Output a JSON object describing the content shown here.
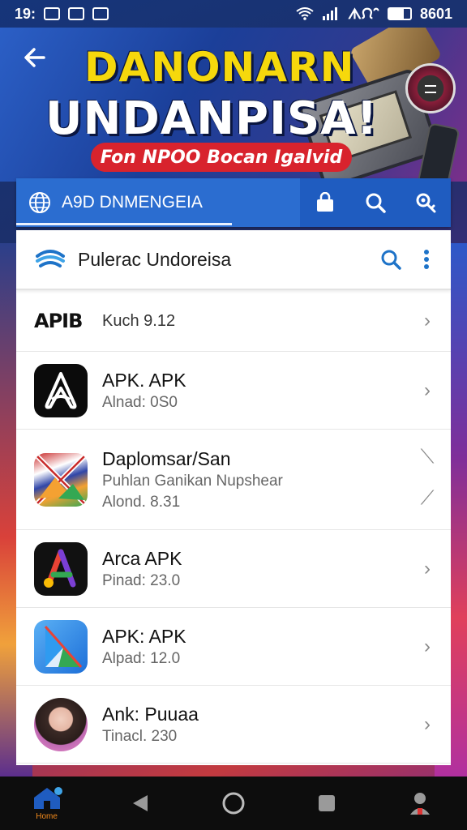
{
  "status_bar": {
    "time": "19:",
    "right_text": "ᗑᙁᐢ",
    "carrier": "8601",
    "icons": [
      "chat-icon",
      "image-icon",
      "notification-icon",
      "wifi-icon",
      "signal-icon",
      "battery-icon"
    ]
  },
  "hero": {
    "title_line1": "DANONARN",
    "title_line2": "UNDANPISA!",
    "pill": "Fon NPOO Bocan Igalvid"
  },
  "toolbar": {
    "title": "A9D DNMENGEIA",
    "icons": [
      "globe-icon",
      "store-icon",
      "search-icon",
      "settings-icon"
    ]
  },
  "sheet": {
    "title": "Pulerac Undoreisa",
    "items": [
      {
        "badge": "APIB",
        "title": "Kuch 9.12",
        "icon": "apib-logo"
      },
      {
        "title": "APK. APK",
        "sub": "Alnad: 0S0",
        "icon": "a-logo-black"
      },
      {
        "title": "Daplomsar/San",
        "sub": "Puhlan  Ganikan Nupshear",
        "sub2": "Alond. 8.31",
        "icon": "flag-icon"
      },
      {
        "title": "Arca APK",
        "sub": "Pinad: 23.0",
        "icon": "colorful-a-icon"
      },
      {
        "title": "APK: APK",
        "sub": "Alpad: 12.0",
        "icon": "blue-a-icon"
      },
      {
        "title": "Ank: Puuaa",
        "sub": "Tinacl. 230",
        "icon": "avatar"
      }
    ]
  },
  "navbar": {
    "home_label": "Home",
    "icons": [
      "home-icon",
      "back-icon",
      "home-circle-icon",
      "recents-icon",
      "profile-icon"
    ]
  },
  "colors": {
    "toolbar_blue": "#2b6dd0",
    "hero_yellow": "#f6d80c",
    "pill_red": "#d8232d",
    "accent_blue": "#1e73c8"
  }
}
